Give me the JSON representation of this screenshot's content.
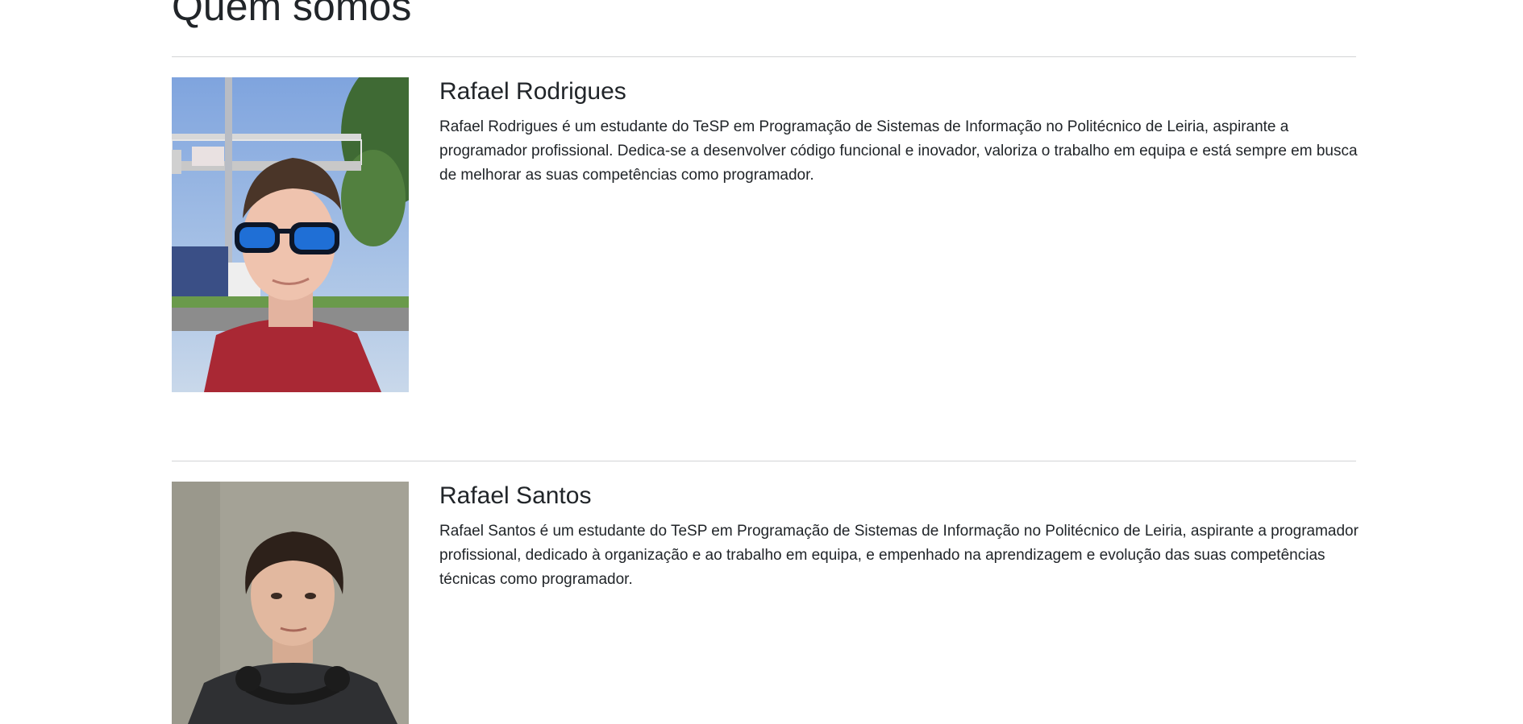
{
  "page": {
    "title": "Quem somos"
  },
  "members": [
    {
      "name": "Rafael Rodrigues",
      "bio": "Rafael Rodrigues é um estudante do TeSP em Programação de Sistemas de Informação no Politécnico de Leiria, aspirante a programador profissional. Dedica-se a desenvolver código funcional e inovador, valoriza o trabalho em equipa e está sempre em busca de melhorar as suas competências como programador.",
      "photo_icon": "portrait-photo"
    },
    {
      "name": "Rafael Santos",
      "bio": "Rafael Santos é um estudante do TeSP em Programação de Sistemas de Informação no Politécnico de Leiria, aspirante a programador profissional, dedicado à organização e ao trabalho em equipa, e empenhado na aprendizagem e evolução das suas competências técnicas como programador.",
      "photo_icon": "portrait-photo"
    }
  ],
  "colors": {
    "text": "#212529",
    "divider": "#d2d4d6",
    "background": "#ffffff"
  }
}
